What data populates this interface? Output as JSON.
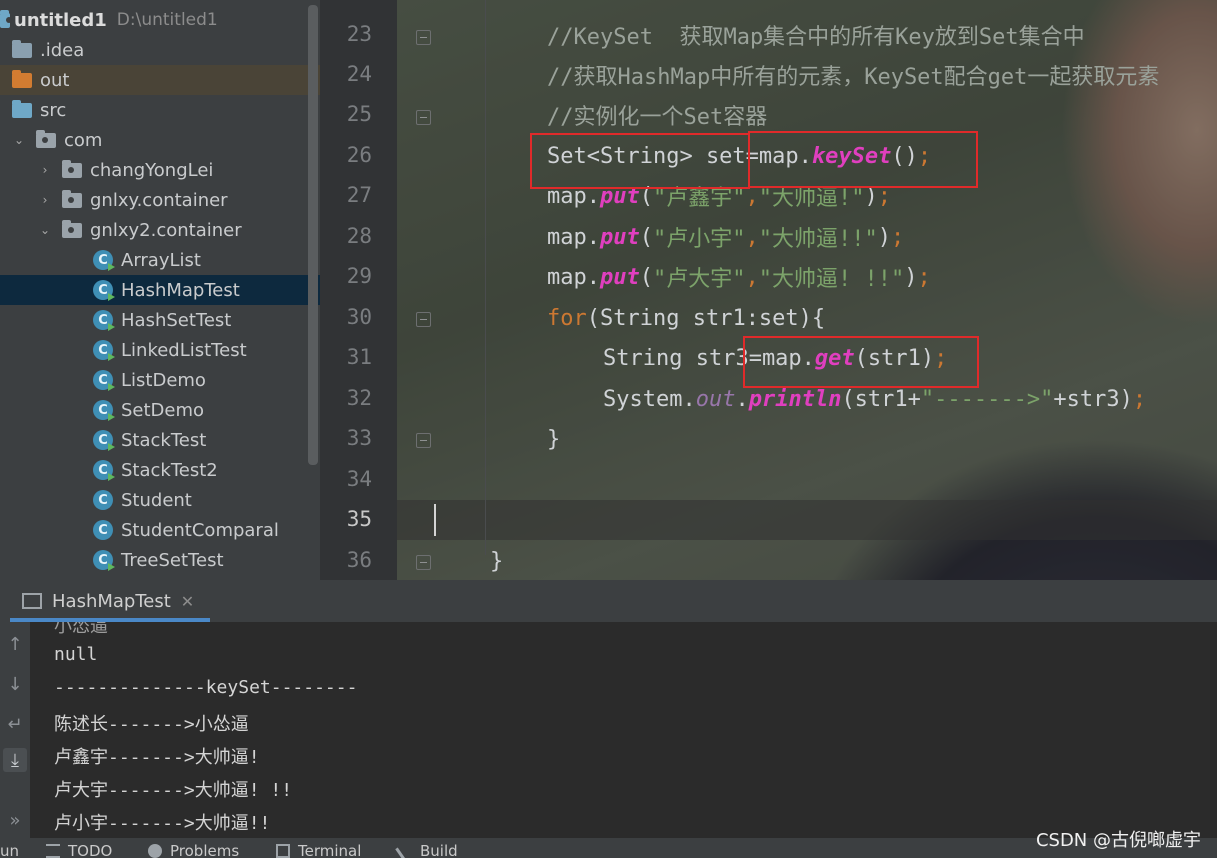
{
  "project_tree": {
    "root": {
      "label": "untitled1",
      "path": "D:\\untitled1"
    },
    "items": [
      {
        "label": ".idea",
        "type": "folder-idea"
      },
      {
        "label": "out",
        "type": "folder-out"
      },
      {
        "label": "src",
        "type": "folder-src"
      },
      {
        "label": "com",
        "type": "package"
      },
      {
        "label": "changYongLei",
        "type": "package"
      },
      {
        "label": "gnlxy.container",
        "type": "package"
      },
      {
        "label": "gnlxy2.container",
        "type": "package"
      },
      {
        "label": "ArrayList",
        "type": "class"
      },
      {
        "label": "HashMapTest",
        "type": "class"
      },
      {
        "label": "HashSetTest",
        "type": "class"
      },
      {
        "label": "LinkedListTest",
        "type": "class"
      },
      {
        "label": "ListDemo",
        "type": "class"
      },
      {
        "label": "SetDemo",
        "type": "class"
      },
      {
        "label": "StackTest",
        "type": "class"
      },
      {
        "label": "StackTest2",
        "type": "class"
      },
      {
        "label": "Student",
        "type": "class"
      },
      {
        "label": "StudentComparal",
        "type": "class"
      },
      {
        "label": "TreeSetTest",
        "type": "class"
      }
    ]
  },
  "editor": {
    "line_numbers": [
      "23",
      "24",
      "25",
      "26",
      "27",
      "28",
      "29",
      "30",
      "31",
      "32",
      "33",
      "34",
      "35",
      "36"
    ],
    "active_line": "35",
    "code": {
      "l23": "//KeySet  获取Map集合中的所有Key放到Set集合中",
      "l24": "//获取HashMap中所有的元素，KeySet配合get一起获取元素",
      "l25": "//实例化一个Set容器",
      "l26_a": "Set<String> set=map.",
      "l26_m": "keySet",
      "l26_b": "()",
      "l26_s": ";",
      "l27_a": "map.",
      "l27_m": "put",
      "l27_p1": "(",
      "l27_s1": "\"卢鑫宇\"",
      "l27_c": ",",
      "l27_s2": "\"大帅逼!\"",
      "l27_p2": ")",
      "l27_e": ";",
      "l28_s1": "\"卢小宇\"",
      "l28_s2": "\"大帅逼!!\"",
      "l29_s1": "\"卢大宇\"",
      "l29_s2": "\"大帅逼! !!\"",
      "l30_kw": "for",
      "l30_rest": "(String str1:set){",
      "l31_a": "String str3=map.",
      "l31_m": "get",
      "l31_b": "(str1)",
      "l31_e": ";",
      "l32_a": "System.",
      "l32_f": "out",
      "l32_d": ".",
      "l32_m": "println",
      "l32_b": "(str1+",
      "l32_s": "\"------->\"",
      "l32_c": "+str3)",
      "l32_e": ";",
      "l33": "}",
      "l36": "}"
    }
  },
  "run_panel": {
    "tab_label": "HashMapTest",
    "output": [
      "小怂逼",
      "null",
      "--------------keySet--------",
      "陈述长------->小怂逼",
      "卢鑫宇------->大帅逼!",
      "卢大宇------->大帅逼! !!",
      "卢小宇------->大帅逼!!"
    ]
  },
  "bottom_bar": {
    "run_label": "un",
    "items": [
      "TODO",
      "Problems",
      "Terminal",
      "Build"
    ]
  },
  "watermark": "CSDN @古倪啷虚宇",
  "colors": {
    "keyword": "#cc7832",
    "method": "#e03fbf",
    "string": "#7ca36a",
    "comment": "#9aa29a",
    "highlight_box": "#e02a2a",
    "selection": "#0d293e"
  }
}
